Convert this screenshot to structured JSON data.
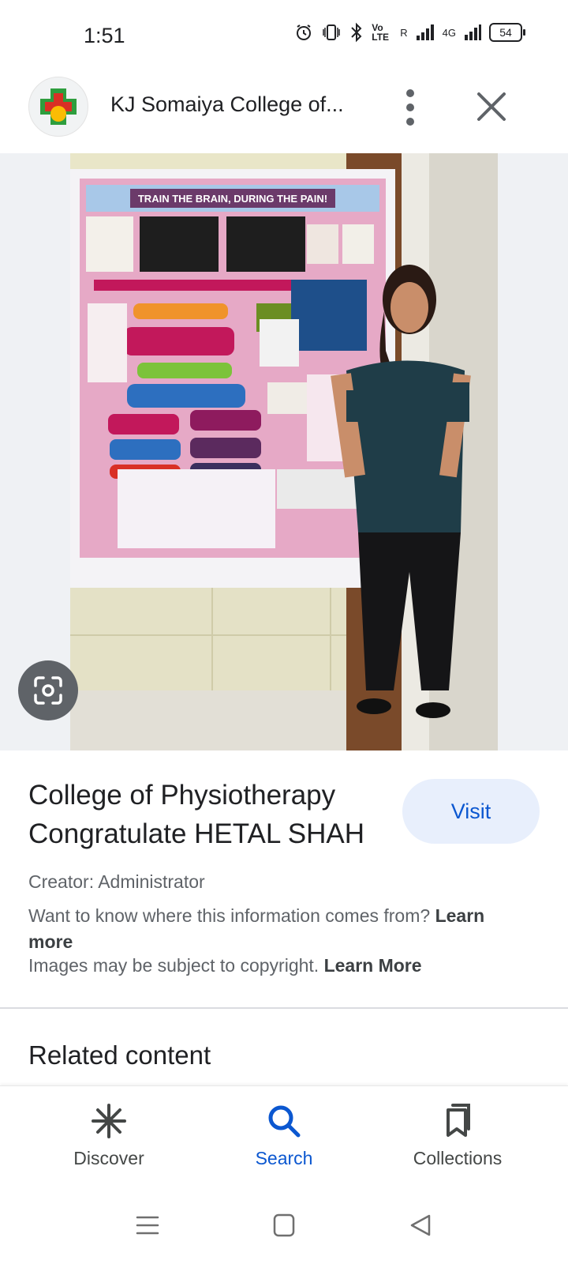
{
  "status_bar": {
    "time": "1:51",
    "network_label": "R",
    "network_type": "4G",
    "volte": "Vo LTE",
    "battery": "54"
  },
  "header": {
    "site_title": "KJ Somaiya College of...",
    "icons": [
      "site-logo",
      "more-vert-icon",
      "close-icon"
    ]
  },
  "image": {
    "poster_title": "TRAIN THE BRAIN, DURING THE PAIN!",
    "lens_icon": "google-lens-icon"
  },
  "details": {
    "title": "College of Physiotherapy Congratulate HETAL SHAH",
    "visit_label": "Visit",
    "creator": "Creator: Administrator",
    "info_text": "Want to know where this information comes from?",
    "info_link": "Learn more",
    "copyright_text": "Images may be subject to copyright.",
    "copyright_link": "Learn More"
  },
  "related": {
    "heading": "Related content"
  },
  "bottom_nav": {
    "items": [
      {
        "label": "Discover",
        "icon": "asterisk-icon",
        "active": false
      },
      {
        "label": "Search",
        "icon": "search-icon",
        "active": true
      },
      {
        "label": "Collections",
        "icon": "bookmarks-icon",
        "active": false
      }
    ]
  },
  "colors": {
    "accent": "#0b57d0",
    "visit_bg": "#e8effc",
    "image_bg": "#eff1f4",
    "text_primary": "#202124",
    "text_secondary": "#5f6368"
  }
}
